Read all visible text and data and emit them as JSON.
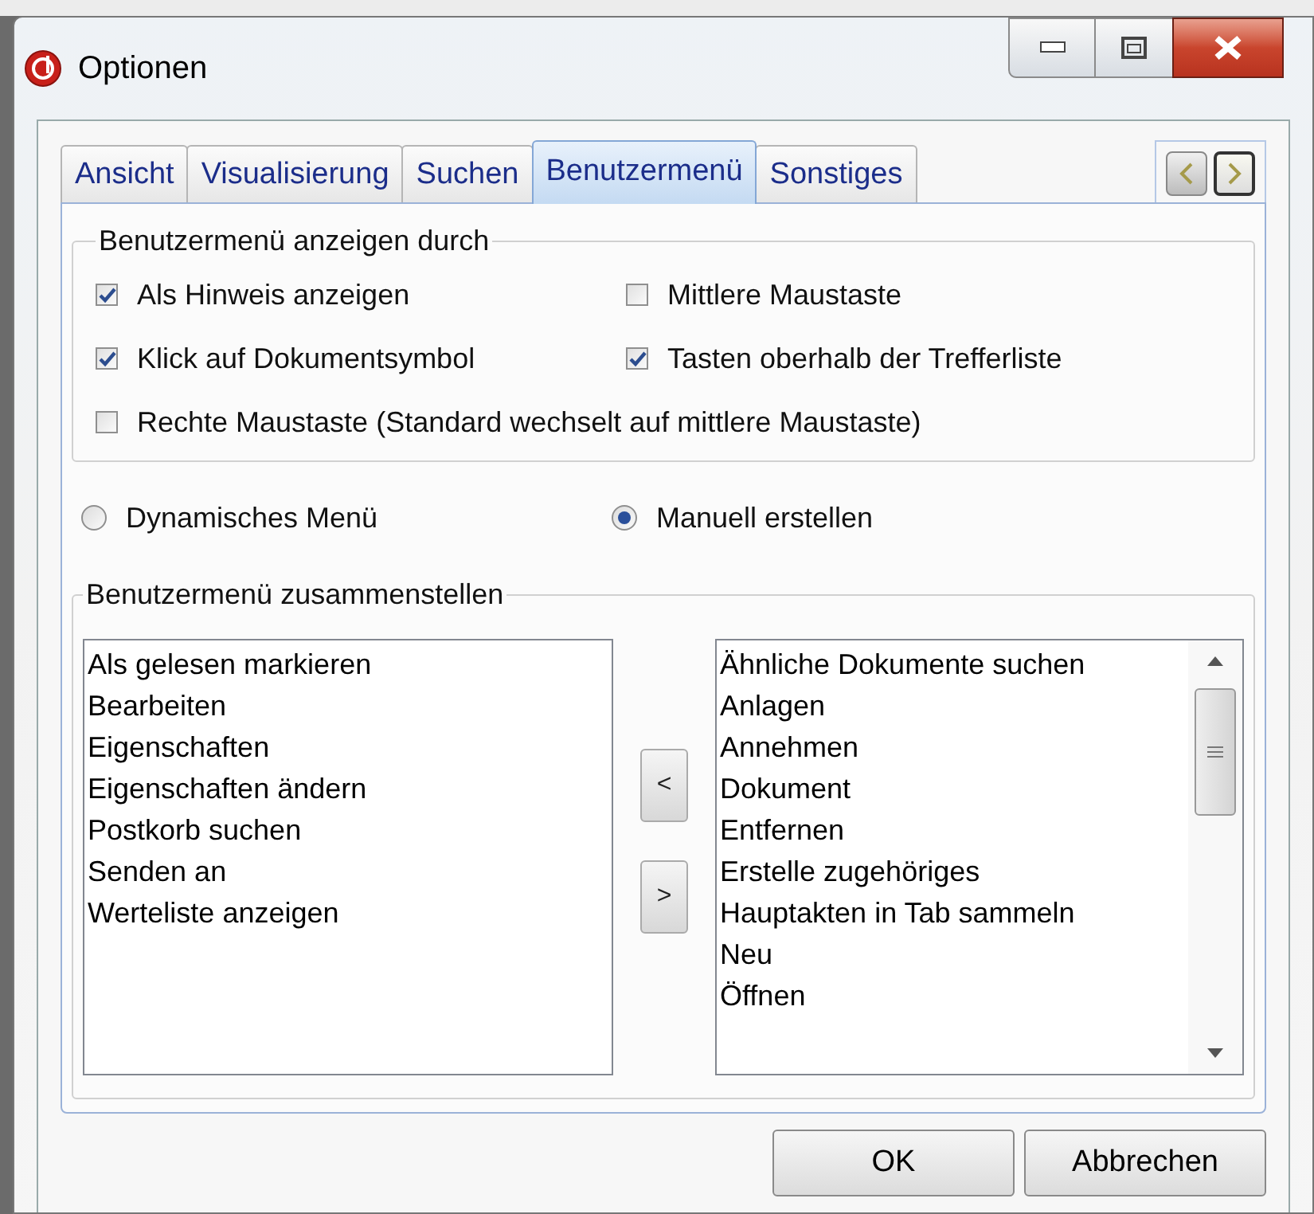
{
  "window": {
    "title": "Optionen"
  },
  "tabs": [
    {
      "label": "Ansicht",
      "selected": false
    },
    {
      "label": "Visualisierung",
      "selected": false
    },
    {
      "label": "Suchen",
      "selected": false
    },
    {
      "label": "Benutzermenü",
      "selected": true
    },
    {
      "label": "Sonstiges",
      "selected": false
    }
  ],
  "display_group": {
    "title": "Benutzermenü anzeigen durch",
    "options": [
      {
        "label": "Als Hinweis anzeigen",
        "checked": true
      },
      {
        "label": "Mittlere Maustaste",
        "checked": false
      },
      {
        "label": "Klick auf Dokumentsymbol",
        "checked": true
      },
      {
        "label": "Tasten oberhalb der Trefferliste",
        "checked": true
      },
      {
        "label": "Rechte Maustaste (Standard wechselt auf mittlere Maustaste)",
        "checked": false
      }
    ]
  },
  "menu_mode": [
    {
      "label": "Dynamisches Menü",
      "selected": false
    },
    {
      "label": "Manuell erstellen",
      "selected": true
    }
  ],
  "compose_group": {
    "title": "Benutzermenü zusammenstellen",
    "available": [
      "Als gelesen markieren",
      "Bearbeiten",
      "Eigenschaften",
      "Eigenschaften ändern",
      "Postkorb suchen",
      "Senden an",
      "Werteliste anzeigen"
    ],
    "move_buttons": [
      "<",
      ">"
    ],
    "selected_items": [
      "Ähnliche Dokumente suchen",
      "Anlagen",
      "Annehmen",
      "Dokument",
      "Entfernen",
      "Erstelle zugehöriges",
      "Hauptakten in Tab sammeln",
      "Neu",
      "Öffnen"
    ]
  },
  "buttons": [
    "OK",
    "Abbrechen"
  ]
}
